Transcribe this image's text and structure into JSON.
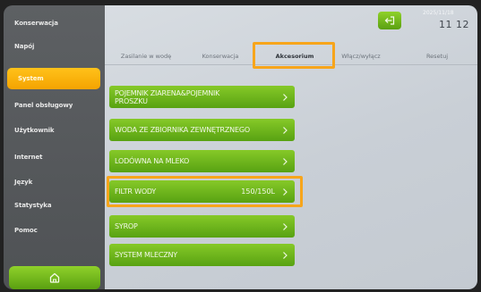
{
  "sidebar": {
    "items": [
      {
        "label": "Konserwacja"
      },
      {
        "label": "Napój"
      },
      {
        "label": "System"
      },
      {
        "label": "Panel obsługowy"
      },
      {
        "label": "Użytkownik"
      },
      {
        "label": "Internet"
      },
      {
        "label": "Język"
      },
      {
        "label": "Statystyka"
      },
      {
        "label": "Pomoc"
      }
    ],
    "active_index": 2,
    "home_icon": "home-icon"
  },
  "header": {
    "exit_icon": "exit-icon",
    "date": "2025/11/18",
    "time": "11 12"
  },
  "tabs": [
    {
      "label": "Zasilanie w wodę"
    },
    {
      "label": "Konserwacja"
    },
    {
      "label": "Akcesorium"
    },
    {
      "label": "Włącz/wyłącz"
    },
    {
      "label": "Resetuj"
    }
  ],
  "active_tab": 2,
  "menu": [
    {
      "label": "POJEMNIK ZIARENA&POJEMNIK PROSZKU",
      "value": ""
    },
    {
      "label": "WODA ZE ZBIORNIKA ZEWNĘTRZNEGO",
      "value": ""
    },
    {
      "label": "LODÓWNA NA MLEKO",
      "value": ""
    },
    {
      "label": "FILTR WODY",
      "value": "150/150L"
    },
    {
      "label": "SYROP",
      "value": ""
    },
    {
      "label": "SYSTEM MLECZNY",
      "value": ""
    }
  ],
  "colors": {
    "accent_green": "#6bb31c",
    "highlight_orange": "#f7a51b",
    "active_sidebar": "#f9b50d"
  }
}
